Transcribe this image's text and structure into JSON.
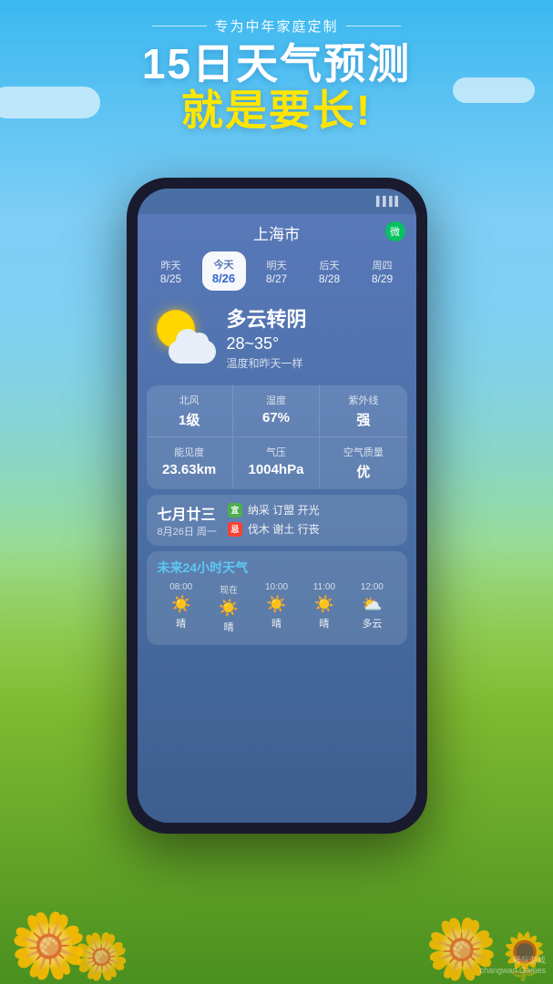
{
  "background": {
    "sky_color_top": "#3bb8f0",
    "sky_color_bottom": "#7ecef5",
    "grass_color": "#5aad2e"
  },
  "top_section": {
    "subtitle": "专为中年家庭定制",
    "title_line1": "15日天气预测",
    "title_line2": "就是要长!"
  },
  "phone": {
    "city": "上海市",
    "wechat_icon": "微",
    "days": [
      {
        "label": "昨天",
        "date": "8/25",
        "active": false
      },
      {
        "label": "今天",
        "date": "8/26",
        "active": true
      },
      {
        "label": "明天",
        "date": "8/27",
        "active": false
      },
      {
        "label": "后天",
        "date": "8/28",
        "active": false
      },
      {
        "label": "周四",
        "date": "8/29",
        "active": false
      }
    ],
    "weather": {
      "description": "多云转阴",
      "temp_range": "28~35°",
      "temp_note": "温度和昨天一样"
    },
    "stats": [
      {
        "label": "北风",
        "value": "1级"
      },
      {
        "label": "湿度",
        "value": "67%"
      },
      {
        "label": "紫外线",
        "value": "强"
      },
      {
        "label": "能见度",
        "value": "23.63km"
      },
      {
        "label": "气压",
        "value": "1004hPa"
      },
      {
        "label": "空气质量",
        "value": "优"
      }
    ],
    "calendar": {
      "lunar_day": "七月廿三",
      "solar_date": "8月26日 周一",
      "good_badge": "宜",
      "good_items": "纳采 订盟 开光",
      "bad_badge": "忌",
      "bad_items": "伐木 谢土 行丧"
    },
    "future_weather": {
      "title": "未来24小时天气",
      "hours": [
        {
          "time": "08:00",
          "weather": "晴",
          "icon": "☀️"
        },
        {
          "time": "现在",
          "weather": "晴",
          "icon": "☀️"
        },
        {
          "time": "10:00",
          "weather": "晴",
          "icon": "☀️"
        },
        {
          "time": "11:00",
          "weather": "晴",
          "icon": "☀️"
        },
        {
          "time": "12:00",
          "weather": "多云",
          "icon": "⛅"
        }
      ]
    }
  },
  "watermark": {
    "line1": "畅玩游戏",
    "line2": "changwan.Games"
  }
}
